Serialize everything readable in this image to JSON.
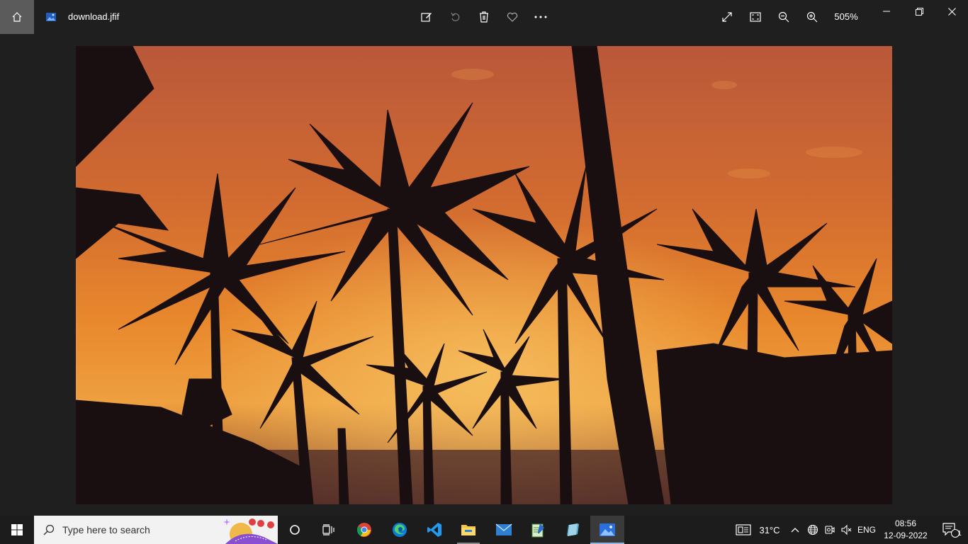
{
  "window": {
    "file_name": "download.jfif",
    "zoom_level": "505%"
  },
  "toolbar": {
    "icons": [
      "home-icon",
      "edit-icon",
      "rotate-icon",
      "delete-icon",
      "favorite-icon",
      "more-icon",
      "fullscreen-icon",
      "fit-to-window-icon",
      "zoom-out-icon",
      "zoom-in-icon"
    ]
  },
  "window_controls": [
    "minimize-icon",
    "restore-icon",
    "close-icon"
  ],
  "photo": {
    "description_colors": {
      "sky_top": "#c8643a",
      "sky_mid": "#e07b2a",
      "glow": "#f0a040",
      "silhouette": "#1a0f10"
    }
  },
  "taskbar": {
    "search_placeholder": "Type here to search",
    "apps": [
      "cortana-icon",
      "task-view-icon",
      "chrome-icon",
      "edge-icon",
      "vscode-icon",
      "file-explorer-icon",
      "mail-icon",
      "notepad-icon",
      "cube-app-icon",
      "photos-icon"
    ],
    "weather": "31°C",
    "language": "ENG",
    "time": "08:56",
    "date": "12-09-2022",
    "notification_count": "1"
  }
}
